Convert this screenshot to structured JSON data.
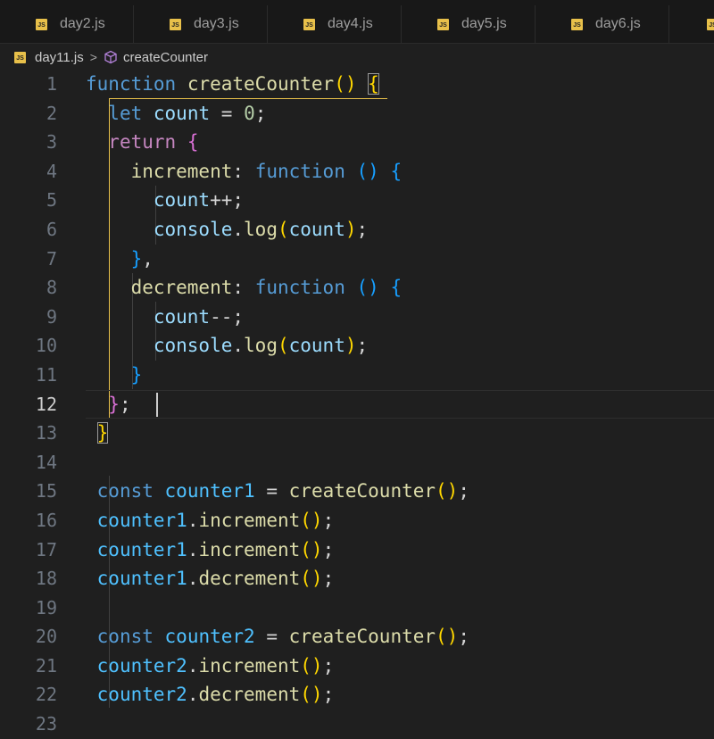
{
  "tabs": [
    {
      "label": "day2.js"
    },
    {
      "label": "day3.js"
    },
    {
      "label": "day4.js"
    },
    {
      "label": "day5.js"
    },
    {
      "label": "day6.js"
    }
  ],
  "tab_icon_text": "JS",
  "breadcrumb": {
    "file": "day11.js",
    "symbol": "createCounter",
    "separator": ">"
  },
  "active_line": 12,
  "line_numbers": [
    "1",
    "2",
    "3",
    "4",
    "5",
    "6",
    "7",
    "8",
    "9",
    "10",
    "11",
    "12",
    "13",
    "14",
    "15",
    "16",
    "17",
    "18",
    "19",
    "20",
    "21",
    "22",
    "23"
  ],
  "tokens": {
    "function": "function",
    "createCounter": "createCounter",
    "let": "let",
    "count": "count",
    "zero": "0",
    "return": "return",
    "increment": "increment",
    "decrement": "decrement",
    "console": "console",
    "log": "log",
    "const": "const",
    "counter1": "counter1",
    "counter2": "counter2"
  },
  "colors": {
    "background": "#1f1f1f",
    "keyword": "#569cd6",
    "control_keyword": "#c586c0",
    "function_name": "#dcdcaa",
    "variable": "#9cdcfe",
    "constant": "#4fc1ff",
    "number": "#b5cea8",
    "bracket_level1": "#ffd700",
    "bracket_level2": "#da70d6",
    "bracket_level3": "#179fff",
    "js_icon": "#e8c04a"
  }
}
